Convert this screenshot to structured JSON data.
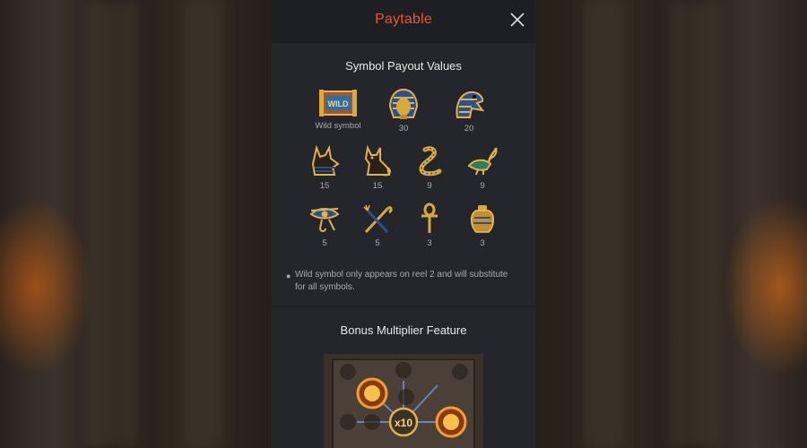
{
  "panel": {
    "title": "Paytable",
    "close_icon": "close-icon"
  },
  "payout": {
    "heading": "Symbol Payout Values",
    "symbols": [
      {
        "icon": "wild-tablet-icon",
        "text": "WILD",
        "label": "Wild symbol"
      },
      {
        "icon": "pharaoh-mask-icon",
        "label": "30"
      },
      {
        "icon": "horus-falcon-icon",
        "label": "20"
      },
      {
        "icon": "anubis-jackal-icon",
        "label": "15"
      },
      {
        "icon": "bastet-cat-icon",
        "label": "15"
      },
      {
        "icon": "cobra-icon",
        "label": "9"
      },
      {
        "icon": "ibis-bird-icon",
        "label": "9"
      },
      {
        "icon": "eye-of-horus-icon",
        "label": "5"
      },
      {
        "icon": "crook-and-flail-icon",
        "label": "5"
      },
      {
        "icon": "ankh-icon",
        "label": "3"
      },
      {
        "icon": "canopic-jar-icon",
        "label": "3"
      }
    ],
    "note": "Wild symbol only appears on reel 2 and will substitute for all symbols."
  },
  "bonus": {
    "heading": "Bonus Multiplier Feature",
    "multiplier_text": "x10",
    "image_icon": "bonus-multiplier-board-image"
  },
  "colors": {
    "title_accent": "#e8572a",
    "panel_bg": "#25262c",
    "gold": "#d9a93a"
  }
}
